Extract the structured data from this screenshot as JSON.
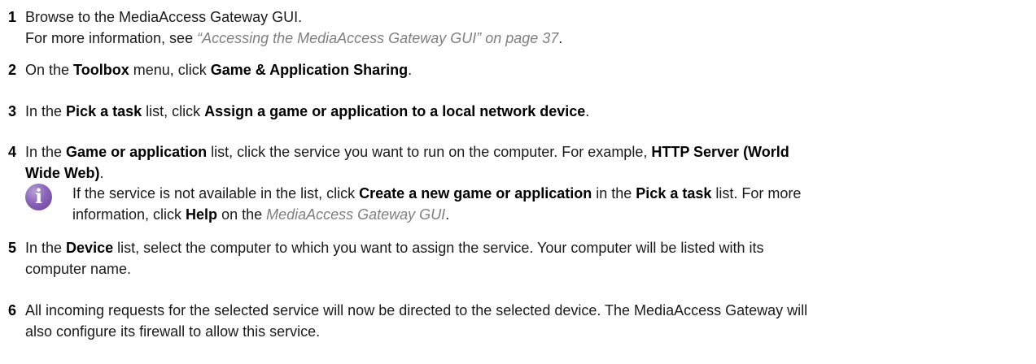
{
  "steps": [
    {
      "number": "1",
      "lines": [
        {
          "a": "Browse to the MediaAccess Gateway GUI."
        },
        {
          "a": "For more information, see ",
          "ref": "“Accessing the MediaAccess Gateway GUI” on page 37",
          "b": "."
        }
      ]
    },
    {
      "number": "2",
      "a": "On the ",
      "b1": "Toolbox",
      "c": " menu, click ",
      "b2": "Game & Application Sharing",
      "d": "."
    },
    {
      "number": "3",
      "a": "In the ",
      "b1": "Pick a task",
      "c": " list, click ",
      "b2": "Assign a game or application to a local network device",
      "d": "."
    },
    {
      "number": "4",
      "a": "In the ",
      "b1": "Game or application",
      "c": " list, click the service you want to run on the computer. For example, ",
      "b2": "HTTP Server (World",
      "b3": "Wide Web)",
      "d": "."
    },
    {
      "number": "5",
      "a": "In the ",
      "b1": "Device",
      "c": " list, select the computer to which you want to assign the service. Your computer will be listed with its",
      "d": "computer name."
    },
    {
      "number": "6",
      "a": "All incoming requests for the selected service will now be directed to the selected device. The MediaAccess Gateway will",
      "b": "also configure its firewall to allow this service."
    }
  ],
  "note": {
    "icon": "info-icon",
    "icon_glyph": "i",
    "a": "If the service is not available in the list, click ",
    "b1": "Create a new game or application",
    "c": " in the ",
    "b2": "Pick a task",
    "d": " list. For more",
    "e": "information, click ",
    "b3": "Help",
    "f": " on the ",
    "ref": "MediaAccess Gateway GUI",
    "g": "."
  }
}
